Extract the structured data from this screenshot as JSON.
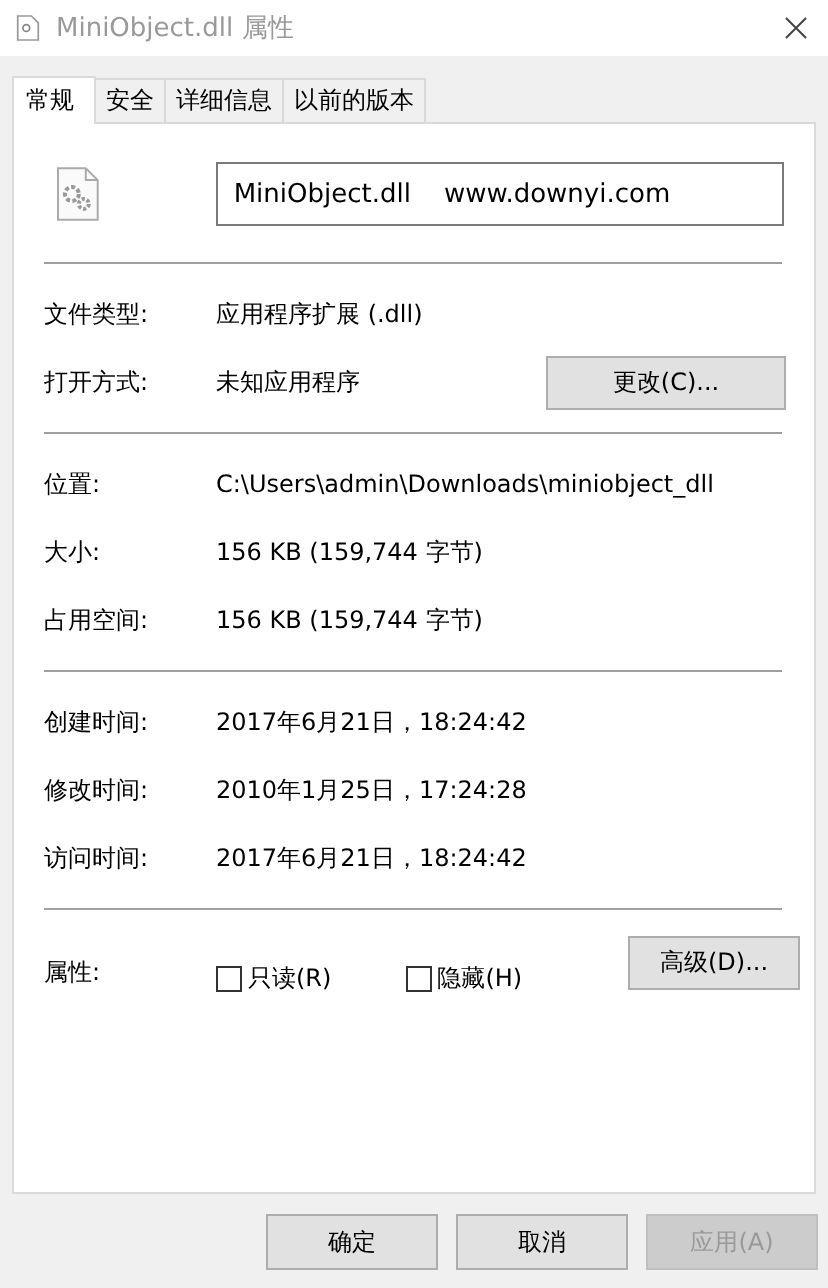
{
  "window": {
    "title": "MiniObject.dll 属性"
  },
  "tabs": [
    {
      "label": "常规",
      "selected": true
    },
    {
      "label": "安全",
      "selected": false
    },
    {
      "label": "详细信息",
      "selected": false
    },
    {
      "label": "以前的版本",
      "selected": false
    }
  ],
  "name_field": {
    "value": "MiniObject.dll    www.downyi.com"
  },
  "sections": [
    [
      {
        "label": "文件类型:",
        "value": "应用程序扩展 (.dll)"
      },
      {
        "label": "打开方式:",
        "value": "未知应用程序",
        "button": "更改(C)..."
      }
    ],
    [
      {
        "label": "位置:",
        "value": "C:\\Users\\admin\\Downloads\\miniobject_dll"
      },
      {
        "label": "大小:",
        "value": "156 KB (159,744 字节)"
      },
      {
        "label": "占用空间:",
        "value": "156 KB (159,744 字节)"
      }
    ],
    [
      {
        "label": "创建时间:",
        "value": "2017年6月21日，18:24:42"
      },
      {
        "label": "修改时间:",
        "value": "2010年1月25日，17:24:28"
      },
      {
        "label": "访问时间:",
        "value": "2017年6月21日，18:24:42"
      }
    ]
  ],
  "attributes": {
    "label": "属性:",
    "checkboxes": [
      {
        "label": "只读(R)",
        "checked": false
      },
      {
        "label": "隐藏(H)",
        "checked": false
      }
    ],
    "button": "高级(D)..."
  },
  "buttons": [
    {
      "label": "确定",
      "disabled": false
    },
    {
      "label": "取消",
      "disabled": false
    },
    {
      "label": "应用(A)",
      "disabled": true
    }
  ]
}
